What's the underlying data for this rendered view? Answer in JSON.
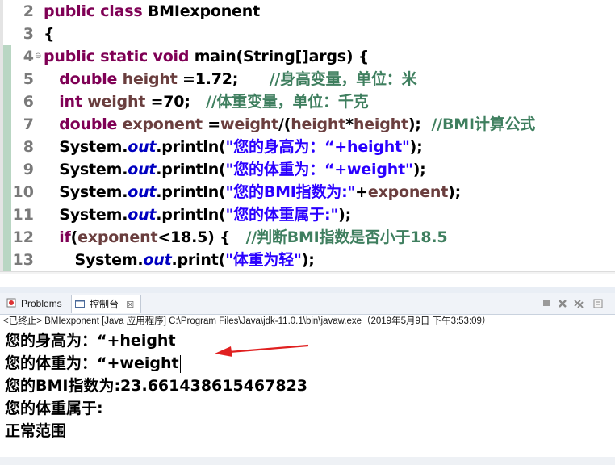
{
  "editor": {
    "lines": [
      {
        "num": "2",
        "fold": "",
        "tokens": [
          {
            "t": "public class ",
            "c": "kw"
          },
          {
            "t": "BMIexponent",
            "c": ""
          }
        ]
      },
      {
        "num": "3",
        "fold": "",
        "tokens": [
          {
            "t": "{",
            "c": ""
          }
        ]
      },
      {
        "num": "4",
        "fold": "⊖",
        "tokens": [
          {
            "t": "public static void ",
            "c": "kw"
          },
          {
            "t": "main(String[]args) {",
            "c": ""
          }
        ]
      },
      {
        "num": "5",
        "fold": "",
        "tokens": [
          {
            "t": "   double ",
            "c": "kw"
          },
          {
            "t": "height",
            "c": "vr"
          },
          {
            "t": " =1.72;      ",
            "c": ""
          },
          {
            "t": "//身高变量，单位：米",
            "c": "cm"
          }
        ]
      },
      {
        "num": "6",
        "fold": "",
        "tokens": [
          {
            "t": "   int ",
            "c": "kw"
          },
          {
            "t": "weight",
            "c": "vr"
          },
          {
            "t": " =70;   ",
            "c": ""
          },
          {
            "t": "//体重变量，单位：千克",
            "c": "cm"
          }
        ]
      },
      {
        "num": "7",
        "fold": "",
        "tokens": [
          {
            "t": "   double ",
            "c": "kw"
          },
          {
            "t": "exponent",
            "c": "vr"
          },
          {
            "t": " =",
            "c": ""
          },
          {
            "t": "weight",
            "c": "vr"
          },
          {
            "t": "/(",
            "c": ""
          },
          {
            "t": "height",
            "c": "vr"
          },
          {
            "t": "*",
            "c": ""
          },
          {
            "t": "height",
            "c": "vr"
          },
          {
            "t": ");  ",
            "c": ""
          },
          {
            "t": "//BMI计算公式",
            "c": "cm"
          }
        ]
      },
      {
        "num": "8",
        "fold": "",
        "tokens": [
          {
            "t": "   System.",
            "c": ""
          },
          {
            "t": "out",
            "c": "st"
          },
          {
            "t": ".println(",
            "c": ""
          },
          {
            "t": "\"您的身高为：“+height\"",
            "c": "str"
          },
          {
            "t": ");",
            "c": ""
          }
        ]
      },
      {
        "num": "9",
        "fold": "",
        "tokens": [
          {
            "t": "   System.",
            "c": ""
          },
          {
            "t": "out",
            "c": "st"
          },
          {
            "t": ".println(",
            "c": ""
          },
          {
            "t": "\"您的体重为：“+weight\"",
            "c": "str"
          },
          {
            "t": ");",
            "c": ""
          }
        ]
      },
      {
        "num": "10",
        "fold": "",
        "tokens": [
          {
            "t": "   System.",
            "c": ""
          },
          {
            "t": "out",
            "c": "st"
          },
          {
            "t": ".println(",
            "c": ""
          },
          {
            "t": "\"您的BMI指数为:\"",
            "c": "str"
          },
          {
            "t": "+",
            "c": ""
          },
          {
            "t": "exponent",
            "c": "vr"
          },
          {
            "t": ");",
            "c": ""
          }
        ]
      },
      {
        "num": "11",
        "fold": "",
        "tokens": [
          {
            "t": "   System.",
            "c": ""
          },
          {
            "t": "out",
            "c": "st"
          },
          {
            "t": ".println(",
            "c": ""
          },
          {
            "t": "\"您的体重属于:\"",
            "c": "str"
          },
          {
            "t": ");",
            "c": ""
          }
        ]
      },
      {
        "num": "12",
        "fold": "",
        "tokens": [
          {
            "t": "   if",
            "c": "kw"
          },
          {
            "t": "(",
            "c": ""
          },
          {
            "t": "exponent",
            "c": "vr"
          },
          {
            "t": "<18.5) {   ",
            "c": ""
          },
          {
            "t": "//判断BMI指数是否小于18.5",
            "c": "cm"
          }
        ]
      },
      {
        "num": "13",
        "fold": "",
        "tokens": [
          {
            "t": "      System.",
            "c": ""
          },
          {
            "t": "out",
            "c": "st"
          },
          {
            "t": ".print(",
            "c": ""
          },
          {
            "t": "\"体重为轻\"",
            "c": "str"
          },
          {
            "t": ");",
            "c": ""
          }
        ]
      }
    ],
    "scroll_left_glyph": "◂"
  },
  "views": {
    "problems_tab": "Problems",
    "console_tab": "控制台",
    "close_glyph": "☒"
  },
  "console": {
    "status": "<已终止> BMIexponent [Java 应用程序] C:\\Program Files\\Java\\jdk-11.0.1\\bin\\javaw.exe（2019年5月9日 下午3:53:09）",
    "output": [
      "您的身高为：“+height",
      "您的体重为：“+weight",
      "您的BMI指数为:23.661438615467823",
      "您的体重属于:",
      "正常范围"
    ]
  },
  "colors": {
    "keyword": "#7f0055",
    "string": "#2a00ff",
    "comment": "#3f7f5f",
    "static_field": "#0000c0",
    "local_variable": "#6a3e3e",
    "annotation_arrow": "#e02020"
  }
}
